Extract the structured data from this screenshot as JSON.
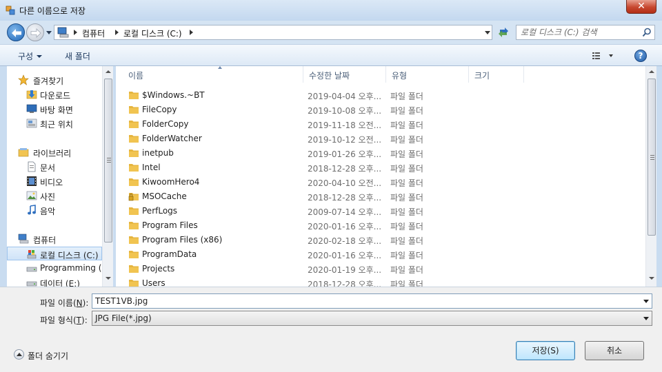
{
  "window": {
    "title": "다른 이름으로 저장",
    "close_label": "✕"
  },
  "address": {
    "crumbs": [
      "컴퓨터",
      "로컬 디스크 (C:)"
    ],
    "search_placeholder": "로컬 디스크 (C:) 검색"
  },
  "toolbar": {
    "organize_label": "구성",
    "new_folder_label": "새 폴더",
    "help_label": "?"
  },
  "nav": {
    "items": [
      {
        "label": "즐겨찾기",
        "icon": "star-icon",
        "level": 0
      },
      {
        "label": "다운로드",
        "icon": "download-icon",
        "level": 1
      },
      {
        "label": "바탕 화면",
        "icon": "desktop-icon",
        "level": 1
      },
      {
        "label": "최근 위치",
        "icon": "recent-places-icon",
        "level": 1
      },
      {
        "label": "라이브러리",
        "icon": "library-icon",
        "level": 0
      },
      {
        "label": "문서",
        "icon": "document-icon",
        "level": 1
      },
      {
        "label": "비디오",
        "icon": "video-icon",
        "level": 1
      },
      {
        "label": "사진",
        "icon": "picture-icon",
        "level": 1
      },
      {
        "label": "음악",
        "icon": "music-icon",
        "level": 1
      },
      {
        "label": "컴퓨터",
        "icon": "computer-icon",
        "level": 0
      },
      {
        "label": "로컬 디스크 (C:)",
        "icon": "local-disk-icon",
        "level": 1,
        "selected": true
      },
      {
        "label": "Programming (D",
        "icon": "drive-icon",
        "level": 1
      },
      {
        "label": "데이터 (E:)",
        "icon": "drive-icon",
        "level": 1
      }
    ]
  },
  "columns": {
    "name": "이름",
    "modified": "수정한 날짜",
    "type": "유형",
    "size": "크기"
  },
  "files": [
    {
      "name": "$Windows.~BT",
      "date": "2019-04-04 오후...",
      "type": "파일 폴더",
      "locked": false
    },
    {
      "name": "FileCopy",
      "date": "2019-10-08 오후...",
      "type": "파일 폴더",
      "locked": false
    },
    {
      "name": "FolderCopy",
      "date": "2019-11-18 오전...",
      "type": "파일 폴더",
      "locked": false
    },
    {
      "name": "FolderWatcher",
      "date": "2019-10-12 오전...",
      "type": "파일 폴더",
      "locked": false
    },
    {
      "name": "inetpub",
      "date": "2019-01-26 오후...",
      "type": "파일 폴더",
      "locked": false
    },
    {
      "name": "Intel",
      "date": "2018-12-28 오후...",
      "type": "파일 폴더",
      "locked": false
    },
    {
      "name": "KiwoomHero4",
      "date": "2020-04-10 오전...",
      "type": "파일 폴더",
      "locked": false
    },
    {
      "name": "MSOCache",
      "date": "2018-12-28 오후...",
      "type": "파일 폴더",
      "locked": true
    },
    {
      "name": "PerfLogs",
      "date": "2009-07-14 오후...",
      "type": "파일 폴더",
      "locked": false
    },
    {
      "name": "Program Files",
      "date": "2020-01-16 오후...",
      "type": "파일 폴더",
      "locked": false
    },
    {
      "name": "Program Files (x86)",
      "date": "2020-02-18 오후...",
      "type": "파일 폴더",
      "locked": false
    },
    {
      "name": "ProgramData",
      "date": "2020-01-16 오후...",
      "type": "파일 폴더",
      "locked": false
    },
    {
      "name": "Projects",
      "date": "2020-01-19 오후...",
      "type": "파일 폴더",
      "locked": false
    },
    {
      "name": "Users",
      "date": "2018-12-28 오후...",
      "type": "파일 폴더",
      "locked": false
    }
  ],
  "form": {
    "filename_label": "파일 이름(",
    "filename_key": "N",
    "filename_label_end": "):",
    "filename_value": "TEST1VB.jpg",
    "filetype_label": "파일 형식(",
    "filetype_key": "T",
    "filetype_label_end": "):",
    "filetype_value": "JPG File(*.jpg)"
  },
  "buttons": {
    "save": "저장(S)",
    "cancel": "취소",
    "hide_folders": "폴더 숨기기"
  },
  "colors": {
    "folder": "#f1c451",
    "selected_bg": "#cfe3f8",
    "accent": "#1d66b8"
  }
}
